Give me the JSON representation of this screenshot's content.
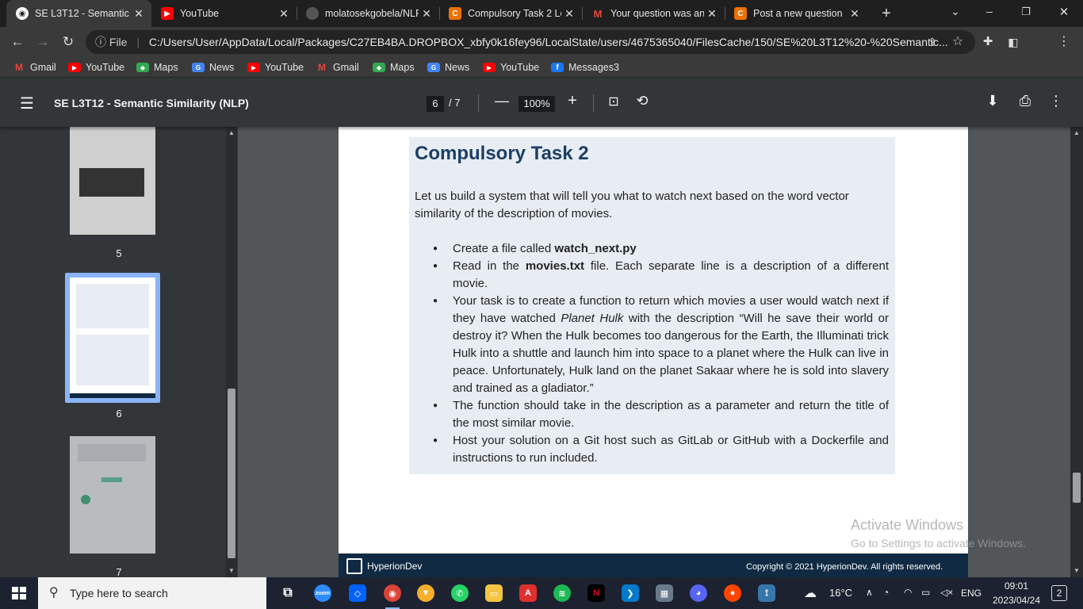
{
  "tabs": [
    {
      "label": "SE L3T12 - Semantic S",
      "favicon": "globe",
      "color": "#ffffff"
    },
    {
      "label": "YouTube",
      "favicon": "youtube",
      "color": "#ff0000"
    },
    {
      "label": "molatosekgobela/NLP",
      "favicon": "github",
      "color": "#333333"
    },
    {
      "label": "Compulsory Task 2 Le",
      "favicon": "chegg-c",
      "color": "#eb7100"
    },
    {
      "label": "Your question was ans",
      "favicon": "gmail",
      "color": "#ea4335"
    },
    {
      "label": "Post a new question",
      "favicon": "chegg-c",
      "color": "#eb7100"
    }
  ],
  "tab_close": "✕",
  "new_tab": "+",
  "window_controls": {
    "minimize": "–",
    "maximize": "❐",
    "close": "✕",
    "tab_search": "⌄"
  },
  "address": {
    "info_label": "ⓘ File",
    "url": "C:/Users/User/AppData/Local/Packages/C27EB4BA.DROPBOX_xbfy0k16fey96/LocalState/users/4675365040/FilesCache/150/SE%20L3T12%20-%20Semantic..."
  },
  "bookmarks": [
    {
      "label": "Gmail",
      "icon": "gmail"
    },
    {
      "label": "YouTube",
      "icon": "youtube"
    },
    {
      "label": "Maps",
      "icon": "maps"
    },
    {
      "label": "News",
      "icon": "news"
    },
    {
      "label": "YouTube",
      "icon": "youtube"
    },
    {
      "label": "Gmail",
      "icon": "gmail"
    },
    {
      "label": "Maps",
      "icon": "maps"
    },
    {
      "label": "News",
      "icon": "news"
    },
    {
      "label": "YouTube",
      "icon": "youtube"
    },
    {
      "label": "Messages3",
      "icon": "facebook"
    }
  ],
  "pdf": {
    "title": "SE L3T12 - Semantic Similarity (NLP)",
    "current_page": "6",
    "total_pages": "/ 7",
    "zoom": "100%",
    "thumb_labels": [
      "5",
      "6",
      "7"
    ]
  },
  "content": {
    "title": "Compulsory Task 2",
    "intro": "Let us build a system that will tell you what to watch next based on the word vector similarity of the description of movies.",
    "bullets": [
      {
        "pre": "Create a file called ",
        "bold": "watch_next.py",
        "post": ""
      },
      {
        "pre": "Read in the ",
        "bold": "movies.txt",
        "post": " file. Each separate line is a description of a different movie."
      },
      {
        "pre": "Your task is to create a function to return which movies a user would watch next if they have watched ",
        "italic": "Planet Hulk",
        "post": " with the description “Will he save their world or destroy it? When the Hulk becomes too dangerous for the Earth, the Illuminati trick Hulk into a shuttle and launch him into space to a planet where the Hulk can live in peace. Unfortunately, Hulk land on the planet Sakaar where he is sold into slavery and trained as a gladiator.”"
      },
      {
        "pre": "The function should take in the description as a parameter and return the title of the most similar movie.",
        "post": ""
      },
      {
        "pre": "Host your solution on a Git host such as GitLab or GitHub with a Dockerfile and instructions to run included.",
        "post": ""
      }
    ],
    "footer_brand": "HyperionDev",
    "footer_copyright": "Copyright © 2021 HyperionDev. All rights reserved."
  },
  "watermark": {
    "line1": "Activate Windows",
    "line2": "Go to Settings to activate Windows."
  },
  "taskbar": {
    "search_placeholder": "Type here to search",
    "weather": "16°C",
    "language": "ENG",
    "time": "09:01",
    "date": "2023/04/24",
    "notifications": "2"
  }
}
